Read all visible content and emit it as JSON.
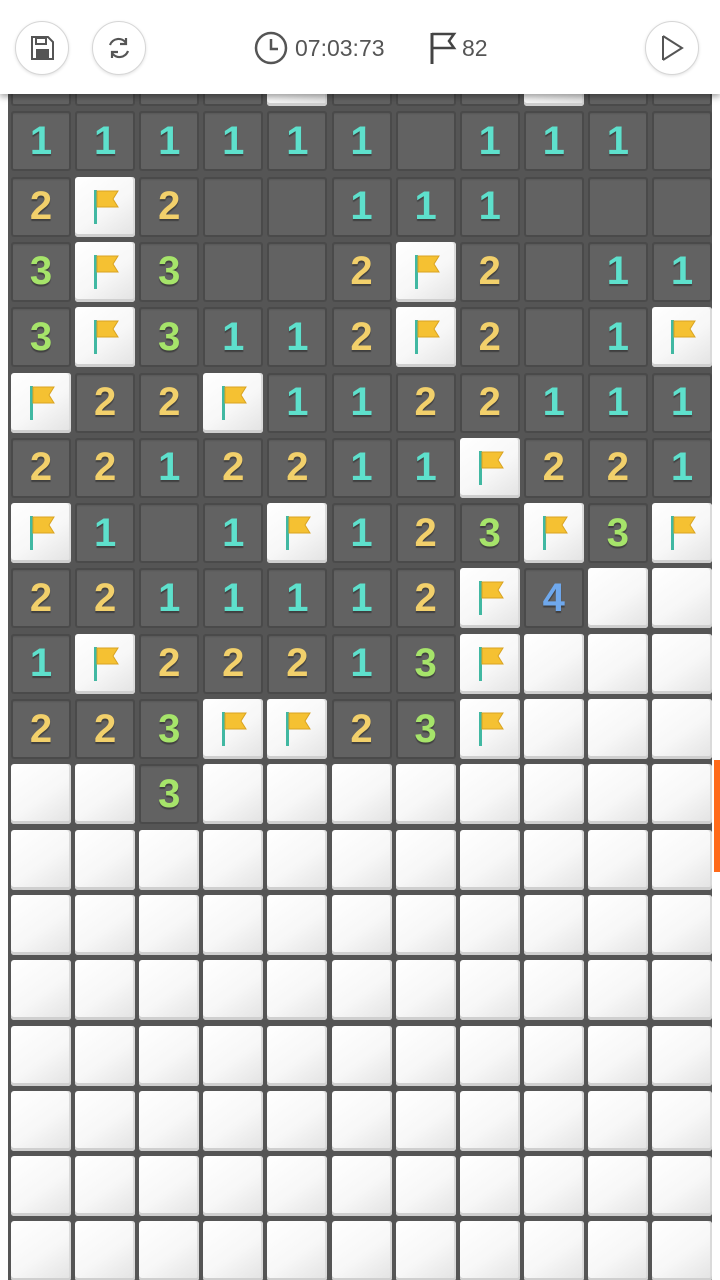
{
  "toolbar": {
    "timer": "07:03:73",
    "flags_remaining": "82",
    "icons": [
      "save-icon",
      "restart-icon",
      "clock-icon",
      "flag-icon",
      "play-icon"
    ]
  },
  "colors": {
    "n1": "#5ee0cc",
    "n2": "#f2d06b",
    "n3": "#a6e46a",
    "n4": "#6fa8ec",
    "flag": "#f5c132",
    "flag_pole": "#41b8a2",
    "accent_scroll": "#ff6a1a"
  },
  "board": {
    "columns": 11,
    "legend": "0-8 = revealed number (0 blank), F = flagged, H = hidden",
    "rows": [
      [
        "0",
        "0",
        "0",
        "0",
        "H",
        "0",
        "0",
        "0",
        "H",
        "0",
        "0"
      ],
      [
        "1",
        "1",
        "1",
        "1",
        "1",
        "1",
        "0",
        "1",
        "1",
        "1",
        "0"
      ],
      [
        "2",
        "F",
        "2",
        "0",
        "0",
        "1",
        "1",
        "1",
        "0",
        "0",
        "0"
      ],
      [
        "3",
        "F",
        "3",
        "0",
        "0",
        "2",
        "F",
        "2",
        "0",
        "1",
        "1"
      ],
      [
        "3",
        "F",
        "3",
        "1",
        "1",
        "2",
        "F",
        "2",
        "0",
        "1",
        "F"
      ],
      [
        "F",
        "2",
        "2",
        "F",
        "1",
        "1",
        "2",
        "2",
        "1",
        "1",
        "1"
      ],
      [
        "2",
        "2",
        "1",
        "2",
        "2",
        "1",
        "1",
        "F",
        "2",
        "2",
        "1"
      ],
      [
        "F",
        "1",
        "0",
        "1",
        "F",
        "1",
        "2",
        "3",
        "F",
        "3",
        "F"
      ],
      [
        "2",
        "2",
        "1",
        "1",
        "1",
        "1",
        "2",
        "F",
        "4",
        "H",
        "H"
      ],
      [
        "1",
        "F",
        "2",
        "2",
        "2",
        "1",
        "3",
        "F",
        "H",
        "H",
        "H"
      ],
      [
        "2",
        "2",
        "3",
        "F",
        "F",
        "2",
        "3",
        "F",
        "H",
        "H",
        "H"
      ],
      [
        "H",
        "H",
        "3",
        "H",
        "H",
        "H",
        "H",
        "H",
        "H",
        "H",
        "H"
      ],
      [
        "H",
        "H",
        "H",
        "H",
        "H",
        "H",
        "H",
        "H",
        "H",
        "H",
        "H"
      ],
      [
        "H",
        "H",
        "H",
        "H",
        "H",
        "H",
        "H",
        "H",
        "H",
        "H",
        "H"
      ],
      [
        "H",
        "H",
        "H",
        "H",
        "H",
        "H",
        "H",
        "H",
        "H",
        "H",
        "H"
      ],
      [
        "H",
        "H",
        "H",
        "H",
        "H",
        "H",
        "H",
        "H",
        "H",
        "H",
        "H"
      ],
      [
        "H",
        "H",
        "H",
        "H",
        "H",
        "H",
        "H",
        "H",
        "H",
        "H",
        "H"
      ],
      [
        "H",
        "H",
        "H",
        "H",
        "H",
        "H",
        "H",
        "H",
        "H",
        "H",
        "H"
      ],
      [
        "H",
        "H",
        "H",
        "H",
        "H",
        "H",
        "H",
        "H",
        "H",
        "H",
        "H"
      ]
    ]
  }
}
